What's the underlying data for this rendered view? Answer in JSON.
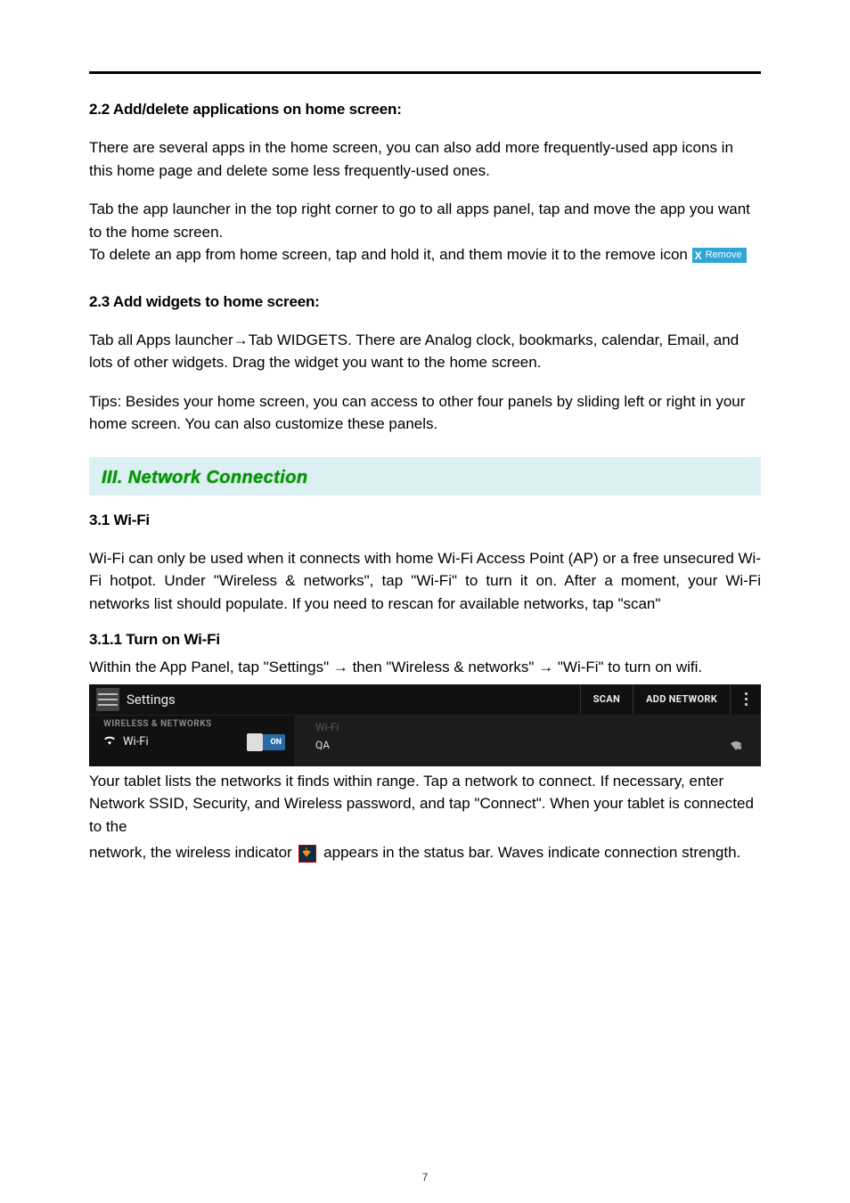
{
  "sections": {
    "s22_title": "2.2 Add/delete applications on home screen:",
    "s22_p1": "There are several apps in the home screen, you can also add more frequently-used app icons in this home page and delete some less frequently-used ones.",
    "s22_p2": "Tab the app launcher in the top right corner to go to all apps panel, tap and move the app you want to the home screen.",
    "s22_p3a": "To delete an app from home screen, tap and hold it, and them movie it to the remove icon ",
    "remove_chip": {
      "x": "X",
      "label": "Remove"
    },
    "s23_title": "2.3 Add widgets to home screen:",
    "s23_p1": "Tab all Apps launcher→Tab WIDGETS. There are Analog clock, bookmarks, calendar, Email, and lots of other widgets. Drag the widget you want to the home screen.",
    "s23_p2": "Tips: Besides your home screen, you can access to other four panels by sliding left or right in your home screen. You can also customize these panels.",
    "band_title": "III. Network Connection",
    "s31_title": "3.1 Wi-Fi",
    "s31_p1": "Wi-Fi can only be used when it connects with home Wi-Fi Access Point (AP) or a free unsecured Wi-Fi hotpot. Under \"Wireless & networks\", tap \"Wi-Fi\" to turn it on. After a moment, your Wi-Fi networks list should populate. If you need to rescan for available networks, tap \"scan\"",
    "s311_title": "3.1.1 Turn on Wi-Fi",
    "s311_p1": "Within the App Panel, tap \"Settings\" → then \"Wireless & networks\" → \"Wi-Fi\" to turn on wifi.",
    "s311_p2a": "  Your tablet lists the networks it finds within range. Tap a network to connect. If necessary, enter Network SSID, Security, and Wireless password, and tap \"Connect\". When your tablet is connected to the",
    "s311_p3a": "network, the wireless indicator ",
    "s311_p3b": " appears in the status bar. Waves indicate connection strength."
  },
  "settings_shot": {
    "title": "Settings",
    "scan": "SCAN",
    "add_network": "ADD NETWORK",
    "left_header": "WIRELESS & NETWORKS",
    "wifi_label": "Wi-Fi",
    "toggle": "ON",
    "right_header": "Wi-Fi",
    "network_name": "QA"
  },
  "page_number": "7"
}
